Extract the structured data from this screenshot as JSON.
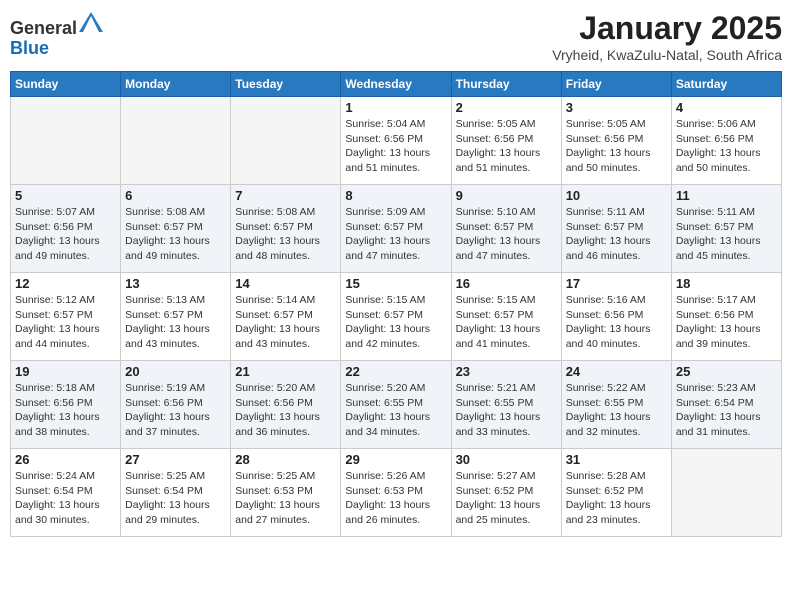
{
  "header": {
    "logo_line1": "General",
    "logo_line2": "Blue",
    "month_title": "January 2025",
    "location": "Vryheid, KwaZulu-Natal, South Africa"
  },
  "weekdays": [
    "Sunday",
    "Monday",
    "Tuesday",
    "Wednesday",
    "Thursday",
    "Friday",
    "Saturday"
  ],
  "weeks": [
    [
      {
        "day": "",
        "info": ""
      },
      {
        "day": "",
        "info": ""
      },
      {
        "day": "",
        "info": ""
      },
      {
        "day": "1",
        "info": "Sunrise: 5:04 AM\nSunset: 6:56 PM\nDaylight: 13 hours\nand 51 minutes."
      },
      {
        "day": "2",
        "info": "Sunrise: 5:05 AM\nSunset: 6:56 PM\nDaylight: 13 hours\nand 51 minutes."
      },
      {
        "day": "3",
        "info": "Sunrise: 5:05 AM\nSunset: 6:56 PM\nDaylight: 13 hours\nand 50 minutes."
      },
      {
        "day": "4",
        "info": "Sunrise: 5:06 AM\nSunset: 6:56 PM\nDaylight: 13 hours\nand 50 minutes."
      }
    ],
    [
      {
        "day": "5",
        "info": "Sunrise: 5:07 AM\nSunset: 6:56 PM\nDaylight: 13 hours\nand 49 minutes."
      },
      {
        "day": "6",
        "info": "Sunrise: 5:08 AM\nSunset: 6:57 PM\nDaylight: 13 hours\nand 49 minutes."
      },
      {
        "day": "7",
        "info": "Sunrise: 5:08 AM\nSunset: 6:57 PM\nDaylight: 13 hours\nand 48 minutes."
      },
      {
        "day": "8",
        "info": "Sunrise: 5:09 AM\nSunset: 6:57 PM\nDaylight: 13 hours\nand 47 minutes."
      },
      {
        "day": "9",
        "info": "Sunrise: 5:10 AM\nSunset: 6:57 PM\nDaylight: 13 hours\nand 47 minutes."
      },
      {
        "day": "10",
        "info": "Sunrise: 5:11 AM\nSunset: 6:57 PM\nDaylight: 13 hours\nand 46 minutes."
      },
      {
        "day": "11",
        "info": "Sunrise: 5:11 AM\nSunset: 6:57 PM\nDaylight: 13 hours\nand 45 minutes."
      }
    ],
    [
      {
        "day": "12",
        "info": "Sunrise: 5:12 AM\nSunset: 6:57 PM\nDaylight: 13 hours\nand 44 minutes."
      },
      {
        "day": "13",
        "info": "Sunrise: 5:13 AM\nSunset: 6:57 PM\nDaylight: 13 hours\nand 43 minutes."
      },
      {
        "day": "14",
        "info": "Sunrise: 5:14 AM\nSunset: 6:57 PM\nDaylight: 13 hours\nand 43 minutes."
      },
      {
        "day": "15",
        "info": "Sunrise: 5:15 AM\nSunset: 6:57 PM\nDaylight: 13 hours\nand 42 minutes."
      },
      {
        "day": "16",
        "info": "Sunrise: 5:15 AM\nSunset: 6:57 PM\nDaylight: 13 hours\nand 41 minutes."
      },
      {
        "day": "17",
        "info": "Sunrise: 5:16 AM\nSunset: 6:56 PM\nDaylight: 13 hours\nand 40 minutes."
      },
      {
        "day": "18",
        "info": "Sunrise: 5:17 AM\nSunset: 6:56 PM\nDaylight: 13 hours\nand 39 minutes."
      }
    ],
    [
      {
        "day": "19",
        "info": "Sunrise: 5:18 AM\nSunset: 6:56 PM\nDaylight: 13 hours\nand 38 minutes."
      },
      {
        "day": "20",
        "info": "Sunrise: 5:19 AM\nSunset: 6:56 PM\nDaylight: 13 hours\nand 37 minutes."
      },
      {
        "day": "21",
        "info": "Sunrise: 5:20 AM\nSunset: 6:56 PM\nDaylight: 13 hours\nand 36 minutes."
      },
      {
        "day": "22",
        "info": "Sunrise: 5:20 AM\nSunset: 6:55 PM\nDaylight: 13 hours\nand 34 minutes."
      },
      {
        "day": "23",
        "info": "Sunrise: 5:21 AM\nSunset: 6:55 PM\nDaylight: 13 hours\nand 33 minutes."
      },
      {
        "day": "24",
        "info": "Sunrise: 5:22 AM\nSunset: 6:55 PM\nDaylight: 13 hours\nand 32 minutes."
      },
      {
        "day": "25",
        "info": "Sunrise: 5:23 AM\nSunset: 6:54 PM\nDaylight: 13 hours\nand 31 minutes."
      }
    ],
    [
      {
        "day": "26",
        "info": "Sunrise: 5:24 AM\nSunset: 6:54 PM\nDaylight: 13 hours\nand 30 minutes."
      },
      {
        "day": "27",
        "info": "Sunrise: 5:25 AM\nSunset: 6:54 PM\nDaylight: 13 hours\nand 29 minutes."
      },
      {
        "day": "28",
        "info": "Sunrise: 5:25 AM\nSunset: 6:53 PM\nDaylight: 13 hours\nand 27 minutes."
      },
      {
        "day": "29",
        "info": "Sunrise: 5:26 AM\nSunset: 6:53 PM\nDaylight: 13 hours\nand 26 minutes."
      },
      {
        "day": "30",
        "info": "Sunrise: 5:27 AM\nSunset: 6:52 PM\nDaylight: 13 hours\nand 25 minutes."
      },
      {
        "day": "31",
        "info": "Sunrise: 5:28 AM\nSunset: 6:52 PM\nDaylight: 13 hours\nand 23 minutes."
      },
      {
        "day": "",
        "info": ""
      }
    ]
  ]
}
